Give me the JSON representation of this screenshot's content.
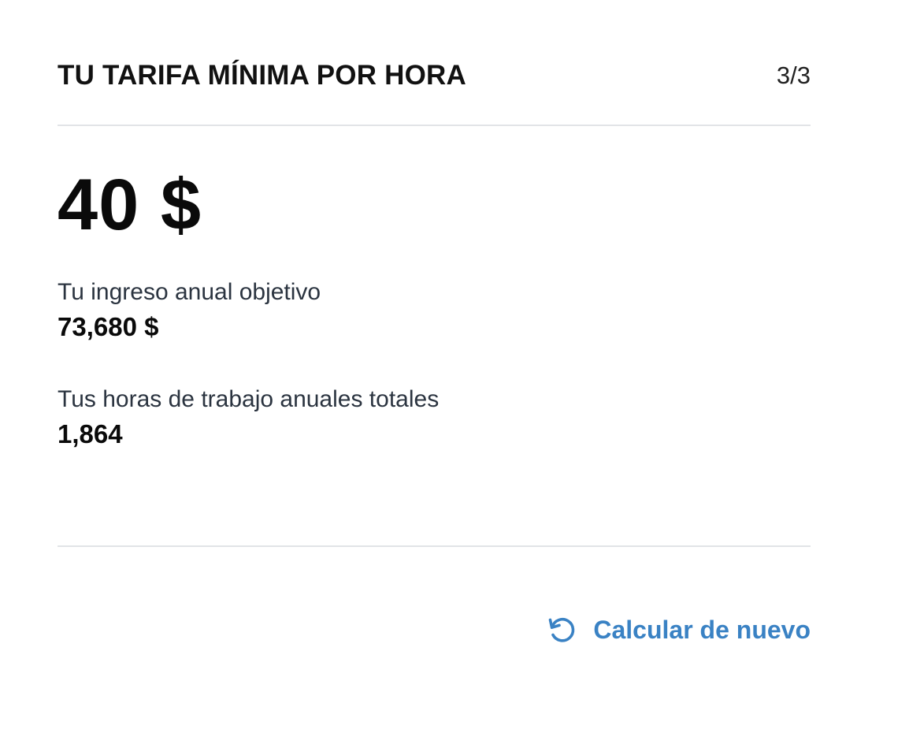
{
  "header": {
    "title": "TU TARIFA MÍNIMA POR HORA",
    "step": "3/3"
  },
  "result": {
    "hourly_rate": "40 $"
  },
  "stats": {
    "income_label": "Tu ingreso anual objetivo",
    "income_value": "73,680 $",
    "hours_label": "Tus horas de trabajo anuales totales",
    "hours_value": "1,864"
  },
  "actions": {
    "recalculate_label": "Calcular de nuevo",
    "recalculate_icon": "refresh-icon",
    "accent_color": "#3a82c4"
  }
}
